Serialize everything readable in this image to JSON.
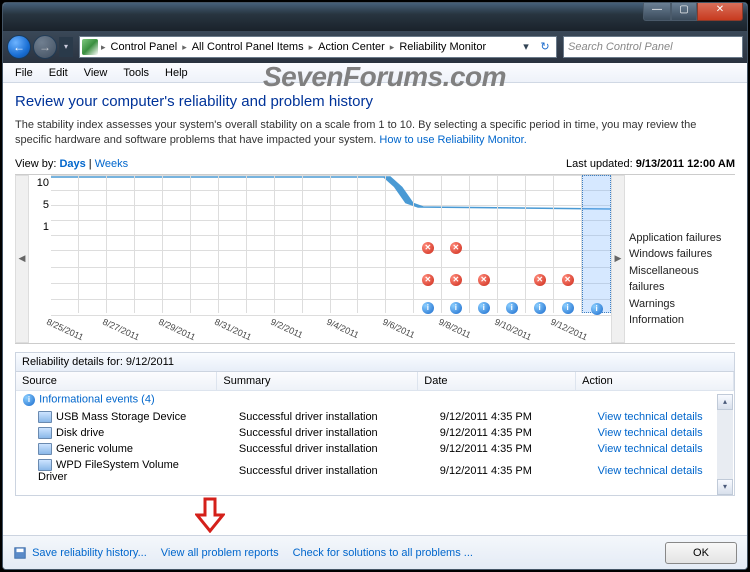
{
  "watermark": "SevenForums.com",
  "titlebar": {
    "min": "—",
    "max": "▢",
    "close": "✕"
  },
  "nav": {
    "back": "←",
    "forward": "→",
    "refresh": "↻",
    "dropdown": "▾"
  },
  "breadcrumbs": [
    "Control Panel",
    "All Control Panel Items",
    "Action Center",
    "Reliability Monitor"
  ],
  "search": {
    "placeholder": "Search Control Panel"
  },
  "menu": [
    "File",
    "Edit",
    "View",
    "Tools",
    "Help"
  ],
  "page": {
    "title": "Review your computer's reliability and problem history",
    "desc": "The stability index assesses your system's overall stability on a scale from 1 to 10. By selecting a specific period in time, you may review the specific hardware and software problems that have impacted your system. ",
    "help_link": "How to use Reliability Monitor.",
    "viewby_label": "View by:",
    "viewby_days": "Days",
    "viewby_sep": " | ",
    "viewby_weeks": "Weeks",
    "last_updated_label": "Last updated: ",
    "last_updated_value": "9/13/2011 12:00 AM"
  },
  "chart_data": {
    "type": "line",
    "ylabel": "",
    "xlabel": "",
    "ylim": [
      1,
      10
    ],
    "yticks": [
      10,
      5,
      1
    ],
    "categories": [
      "8/25/2011",
      "8/27/2011",
      "8/29/2011",
      "8/31/2011",
      "9/2/2011",
      "9/4/2011",
      "9/6/2011",
      "9/8/2011",
      "9/10/2011",
      "9/12/2011"
    ],
    "series": [
      {
        "name": "Stability index",
        "values": [
          10,
          10,
          10,
          10,
          10,
          10,
          6,
          5,
          5,
          5
        ]
      }
    ],
    "selected_index": 9,
    "legend_rows": [
      "Application failures",
      "Windows failures",
      "Miscellaneous failures",
      "Warnings",
      "Information"
    ],
    "markers": {
      "application_failures": {
        "9/5": 1,
        "9/6": 1
      },
      "miscellaneous_failures": {
        "9/5": 1,
        "9/6": 1,
        "9/7": 1,
        "9/9": 1,
        "9/10": 1
      },
      "information": {
        "9/5": 1,
        "9/6": 1,
        "9/7": 1,
        "9/8": 1,
        "9/9": 1,
        "9/10": 1,
        "9/11": 1,
        "9/12": 1
      }
    }
  },
  "details": {
    "header": "Reliability details for: 9/12/2011",
    "columns": [
      "Source",
      "Summary",
      "Date",
      "Action"
    ],
    "group": "Informational events (4)",
    "action_link": "View  technical details",
    "rows": [
      {
        "source": "USB Mass Storage Device",
        "summary": "Successful driver installation",
        "date": "9/12/2011 4:35 PM"
      },
      {
        "source": "Disk drive",
        "summary": "Successful driver installation",
        "date": "9/12/2011 4:35 PM"
      },
      {
        "source": "Generic volume",
        "summary": "Successful driver installation",
        "date": "9/12/2011 4:35 PM"
      },
      {
        "source": "WPD FileSystem Volume Driver",
        "summary": "Successful driver installation",
        "date": "9/12/2011 4:35 PM"
      }
    ]
  },
  "footer": {
    "save": "Save reliability history...",
    "view_all": "View all problem reports",
    "check": "Check for solutions to all problems ...",
    "ok": "OK"
  }
}
